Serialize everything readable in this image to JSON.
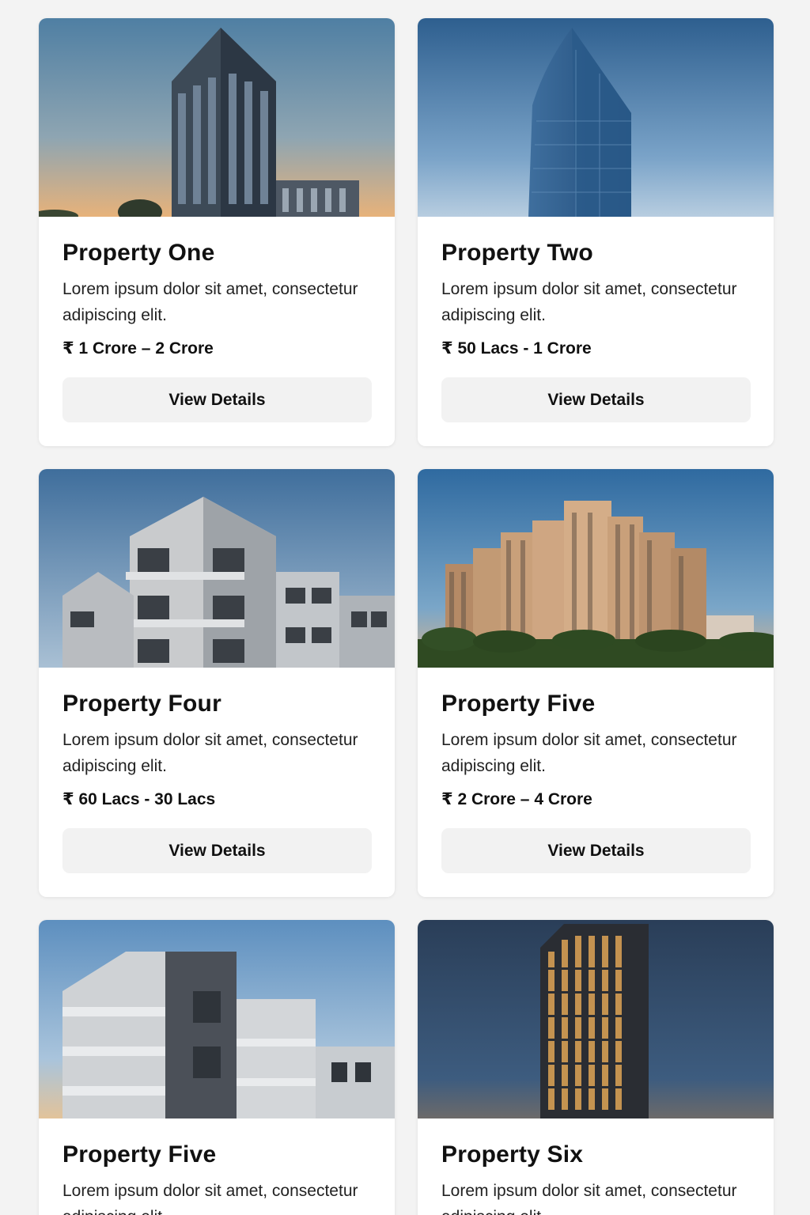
{
  "colors": {
    "page_background": "#f3f3f3",
    "card_background": "#ffffff",
    "button_background": "#f2f2f2",
    "text": "#111111"
  },
  "cards": [
    {
      "image": "building-photo-tower-dusk",
      "title": "Property One",
      "description": "Lorem ipsum dolor sit amet, consectetur adipiscing elit.",
      "price": "₹ 1 Crore – 2 Crore",
      "button_label": "View Details"
    },
    {
      "image": "building-photo-glass-tower",
      "title": "Property Two",
      "description": "Lorem ipsum dolor sit amet, consectetur adipiscing elit.",
      "price": "₹ 50 Lacs - 1 Crore",
      "button_label": "View Details"
    },
    {
      "image": "building-photo-modern-balconies",
      "title": "Property Four",
      "description": "Lorem ipsum dolor sit amet, consectetur adipiscing elit.",
      "price": "₹ 60 Lacs - 30 Lacs",
      "button_label": "View Details"
    },
    {
      "image": "building-photo-apartment-complex",
      "title": "Property Five",
      "description": "Lorem ipsum dolor sit amet, consectetur adipiscing elit.",
      "price": "₹ 2 Crore – 4 Crore",
      "button_label": "View Details"
    },
    {
      "image": "building-photo-modern-balconies-2",
      "title": "Property Five",
      "description": "Lorem ipsum dolor sit amet, consectetur adipiscing elit."
    },
    {
      "image": "building-photo-night-tower",
      "title": "Property Six",
      "description": "Lorem ipsum dolor sit amet, consectetur adipiscing elit."
    }
  ]
}
